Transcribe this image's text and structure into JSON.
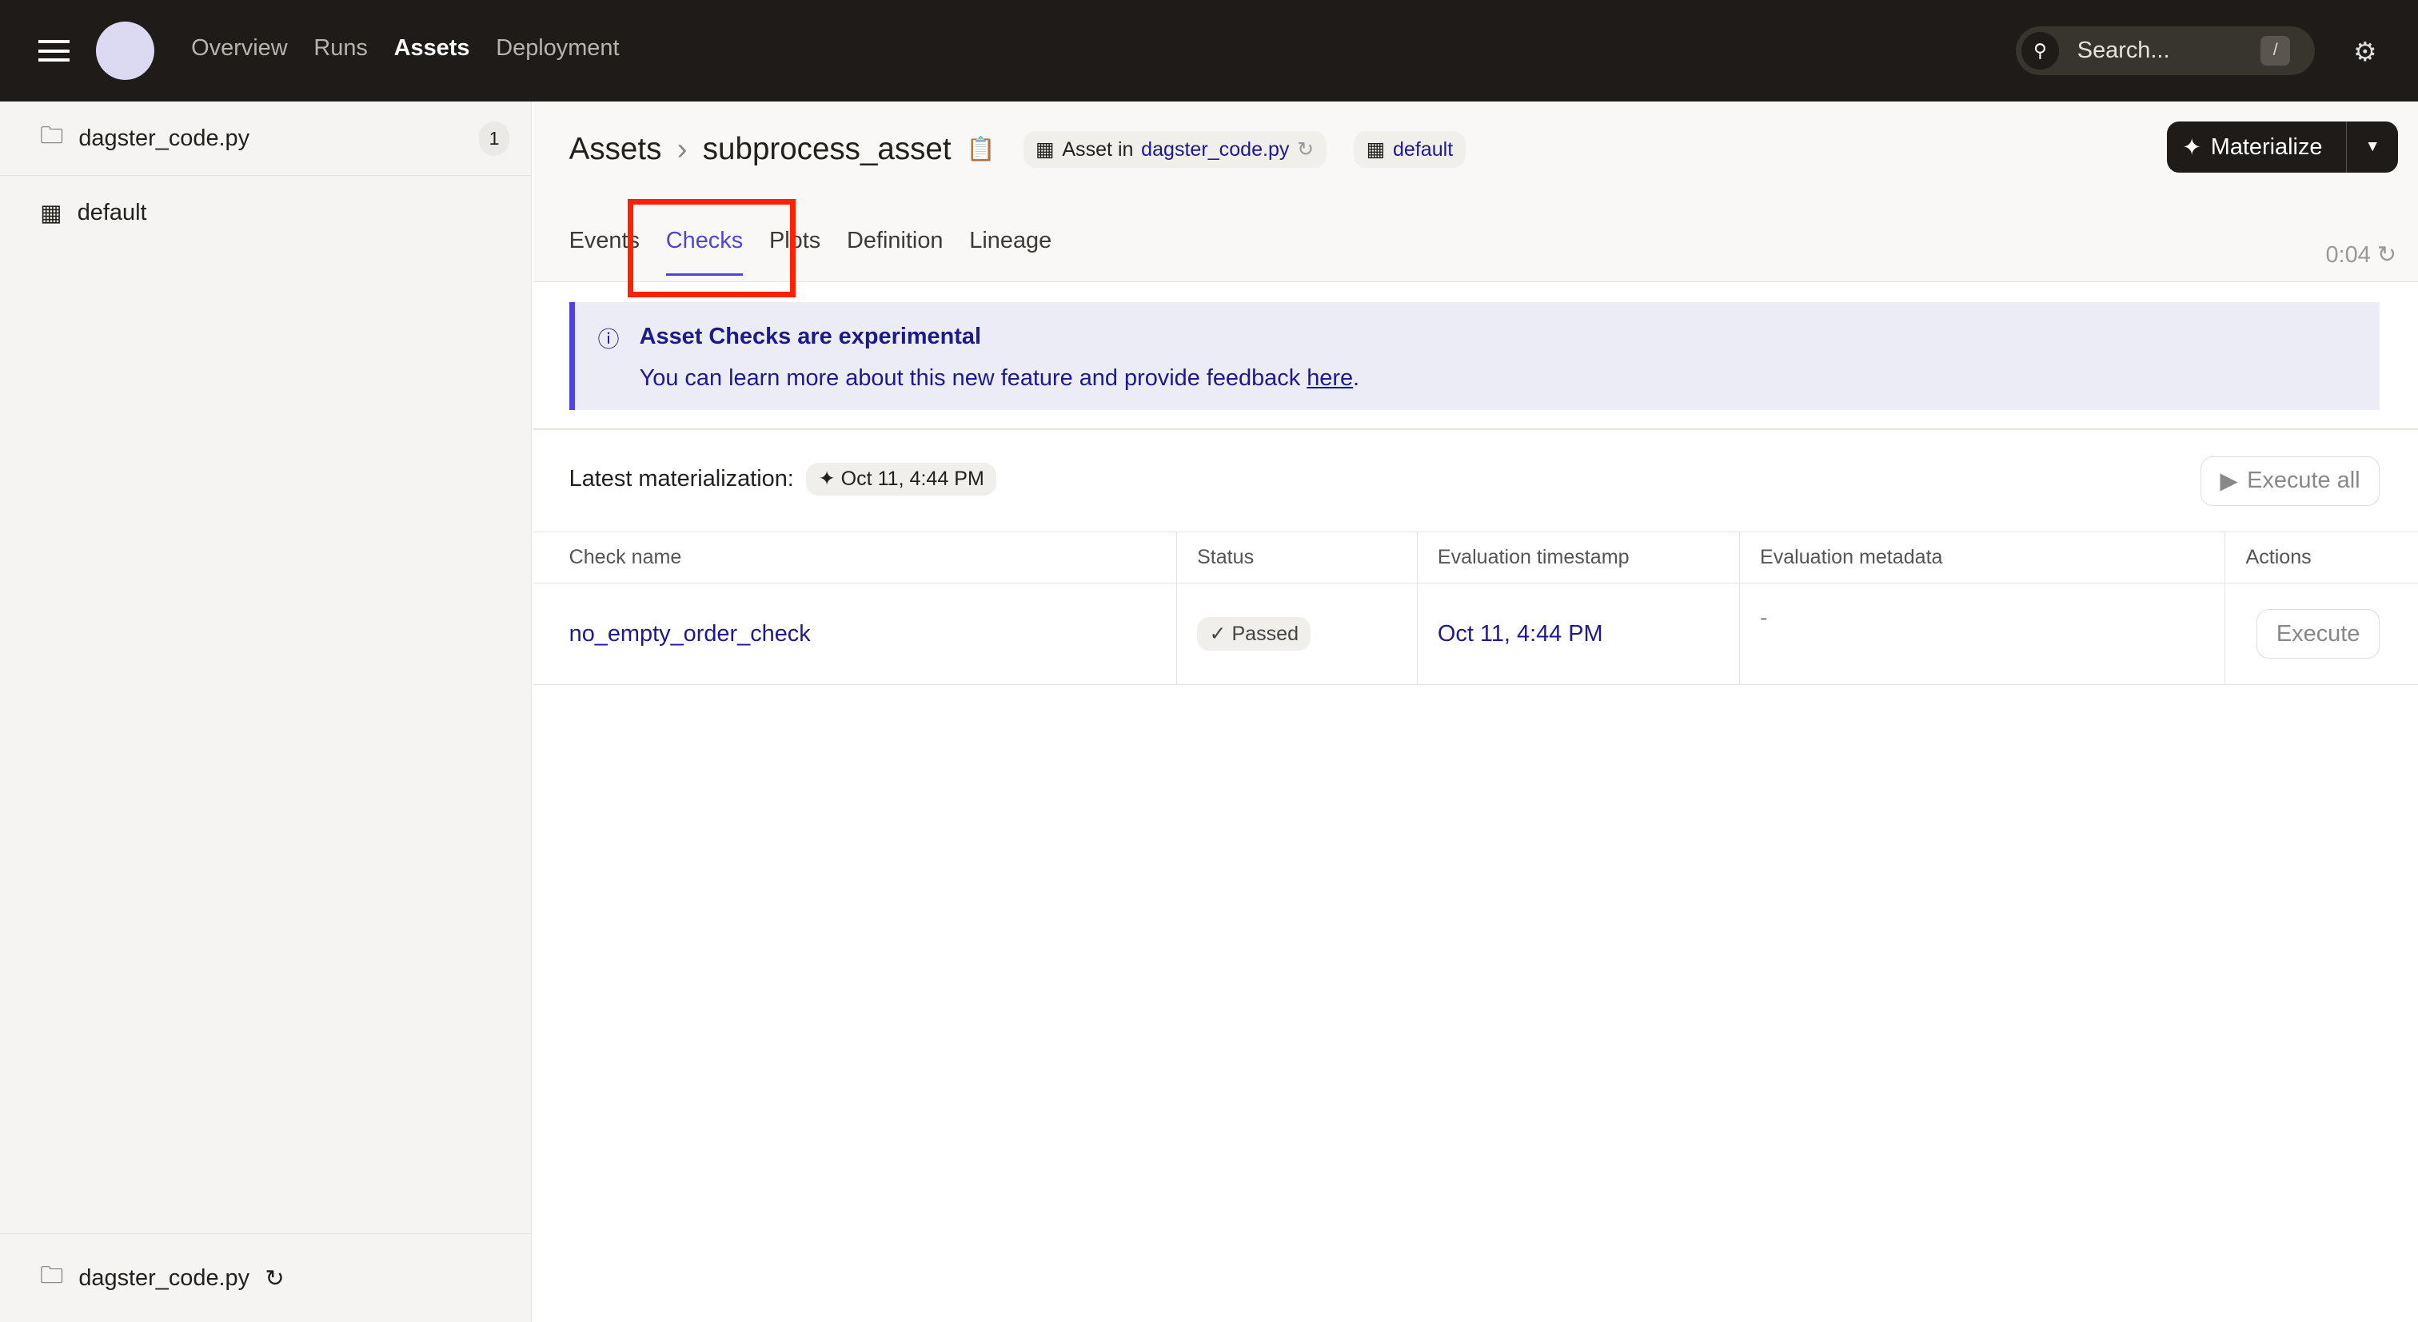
{
  "topnav": {
    "items": [
      "Overview",
      "Runs",
      "Assets",
      "Deployment"
    ],
    "active": "Assets",
    "search_placeholder": "Search...",
    "search_shortcut": "/"
  },
  "sidebar": {
    "location": "dagster_code.py",
    "location_count": "1",
    "group": "default",
    "footer_location": "dagster_code.py"
  },
  "header": {
    "breadcrumb_root": "Assets",
    "asset_name": "subprocess_asset",
    "asset_in_label": "Asset in",
    "code_location": "dagster_code.py",
    "group": "default",
    "materialize_label": "Materialize"
  },
  "tabs": [
    {
      "label": "Events"
    },
    {
      "label": "Checks",
      "active": true
    },
    {
      "label": "Plots"
    },
    {
      "label": "Definition"
    },
    {
      "label": "Lineage"
    }
  ],
  "refresh_timer": "0:04",
  "alert": {
    "title": "Asset Checks are experimental",
    "text": "You can learn more about this new feature and provide feedback ",
    "link": "here",
    "suffix": "."
  },
  "latest": {
    "label": "Latest materialization:",
    "timestamp": "Oct 11, 4:44 PM",
    "execute_all": "Execute all"
  },
  "table": {
    "columns": [
      "Check name",
      "Status",
      "Evaluation timestamp",
      "Evaluation metadata",
      "Actions"
    ],
    "rows": [
      {
        "name": "no_empty_order_check",
        "status": "Passed",
        "timestamp": "Oct 11, 4:44 PM",
        "metadata": "-",
        "action": "Execute"
      }
    ]
  },
  "colors": {
    "accent": "#4f43dd",
    "topbar": "#1f1b18",
    "link": "#1d1a8a",
    "highlight": "#ff2200"
  }
}
